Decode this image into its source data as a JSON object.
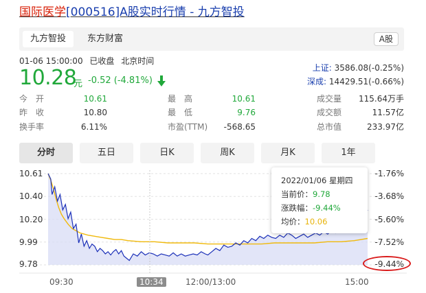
{
  "header": {
    "title_part1": "国际医学",
    "title_part2": "[000516]A股实时行情 - 九方智投"
  },
  "tabs": {
    "items": [
      "九方智投",
      "东方财富"
    ],
    "market_badge": "A股"
  },
  "quote": {
    "datetime": "01-06 15:00:00",
    "status": "已收盘",
    "timezone": "北京时间",
    "price": "10.28",
    "unit": "元",
    "change": "-0.52 (-4.81%)"
  },
  "indices": [
    {
      "label": "上证:",
      "value": "3586.08(-0.25%)"
    },
    {
      "label": "深成:",
      "value": "14429.51(-0.66%)"
    }
  ],
  "stats": {
    "row1": [
      {
        "label": "今　开",
        "value": "10.61",
        "green": true
      },
      {
        "label": "最　高",
        "value": "10.61",
        "green": true
      },
      {
        "label": "成交量",
        "value": "115.64万手",
        "green": false
      }
    ],
    "row2": [
      {
        "label": "昨　收",
        "value": "10.80",
        "green": false
      },
      {
        "label": "最　低",
        "value": "9.76",
        "green": true
      },
      {
        "label": "成交额",
        "value": "11.57亿",
        "green": false
      }
    ],
    "row3": [
      {
        "label": "换手率",
        "value": "6.11%",
        "green": false
      },
      {
        "label": "市盈(TTM)",
        "value": "-568.65",
        "green": false
      },
      {
        "label": "总市值",
        "value": "233.97亿",
        "green": false
      }
    ]
  },
  "range_tabs": [
    "分时",
    "五日",
    "日K",
    "周K",
    "月K",
    "1年"
  ],
  "tooltip": {
    "date": "2022/01/06 星期四",
    "current_label": "当前价：",
    "current_value": "9.78",
    "change_label": "涨跌幅：",
    "change_value": "-9.44%",
    "avg_label": "均价：",
    "avg_value": "10.06"
  },
  "colors": {
    "up_red": "#d81e06",
    "down_green": "#20a83a",
    "price_line": "#1a2fb8",
    "avg_line": "#f0b90b",
    "area_fill": "#d8dcf6",
    "link_blue": "#1a3fae"
  },
  "chart_data": {
    "type": "line",
    "y_ticks": [
      "10.61",
      "10.40",
      "10.20",
      "9.99",
      "9.78"
    ],
    "pct_ticks": [
      "-1.76%",
      "-3.68%",
      "-5.60%",
      "-7.52%",
      "-9.44%"
    ],
    "x_ticks": [
      "09:30",
      "10:34",
      "12:00/13:00",
      "15:00"
    ],
    "ylim": [
      9.78,
      10.61
    ],
    "x_domain": [
      0,
      240
    ],
    "series": [
      {
        "name": "当前价",
        "x": [
          0,
          2,
          3,
          5,
          7,
          9,
          11,
          13,
          15,
          17,
          19,
          21,
          23,
          25,
          27,
          29,
          31,
          33,
          35,
          37,
          39,
          41,
          43,
          45,
          47,
          49,
          51,
          53,
          55,
          57,
          59,
          61,
          64,
          67,
          70,
          73,
          76,
          79,
          82,
          85,
          88,
          91,
          94,
          97,
          100,
          103,
          106,
          109,
          112,
          115,
          118,
          120,
          123,
          126,
          129,
          132,
          135,
          138,
          141,
          144,
          147,
          150,
          153,
          156,
          159,
          162,
          165,
          168,
          171,
          174,
          177,
          180,
          183,
          186,
          189,
          192,
          195,
          198,
          201,
          204,
          207,
          210,
          213,
          216,
          219,
          222,
          225,
          228,
          231,
          234,
          237,
          240
        ],
        "values": [
          10.61,
          10.56,
          10.42,
          10.49,
          10.36,
          10.42,
          10.28,
          10.33,
          10.2,
          10.26,
          10.11,
          10.15,
          9.98,
          10.06,
          9.95,
          10.0,
          9.93,
          9.97,
          9.95,
          9.9,
          9.93,
          9.91,
          9.88,
          9.9,
          9.87,
          9.9,
          9.92,
          9.88,
          9.91,
          9.86,
          9.84,
          9.82,
          9.88,
          9.86,
          9.9,
          9.87,
          9.89,
          9.88,
          9.86,
          9.88,
          9.87,
          9.86,
          9.89,
          9.86,
          9.88,
          9.86,
          9.87,
          9.88,
          9.87,
          9.9,
          9.88,
          9.87,
          9.9,
          9.93,
          9.91,
          9.96,
          9.94,
          9.95,
          9.98,
          9.96,
          10.0,
          9.98,
          10.02,
          10.0,
          10.04,
          10.02,
          10.05,
          10.03,
          10.02,
          10.05,
          10.03,
          10.07,
          10.05,
          10.02,
          10.04,
          10.06,
          10.03,
          10.05,
          10.07,
          10.05,
          10.08,
          10.06,
          10.09,
          10.07,
          10.1,
          10.08,
          10.11,
          10.09,
          10.12,
          10.14,
          10.21,
          10.28
        ]
      },
      {
        "name": "均价",
        "x": [
          0,
          2,
          4,
          6,
          8,
          10,
          12,
          15,
          18,
          21,
          24,
          27,
          30,
          35,
          40,
          45,
          50,
          55,
          60,
          70,
          80,
          90,
          100,
          110,
          120,
          130,
          140,
          150,
          160,
          170,
          180,
          190,
          200,
          210,
          220,
          230,
          240
        ],
        "values": [
          10.61,
          10.55,
          10.47,
          10.38,
          10.3,
          10.24,
          10.2,
          10.15,
          10.11,
          10.09,
          10.07,
          10.06,
          10.05,
          10.04,
          10.03,
          10.02,
          10.01,
          10.01,
          10.0,
          9.99,
          9.99,
          9.98,
          9.98,
          9.98,
          9.97,
          9.97,
          9.97,
          9.97,
          9.97,
          9.98,
          9.98,
          9.98,
          9.98,
          9.99,
          9.99,
          10.0,
          10.02
        ]
      }
    ]
  }
}
